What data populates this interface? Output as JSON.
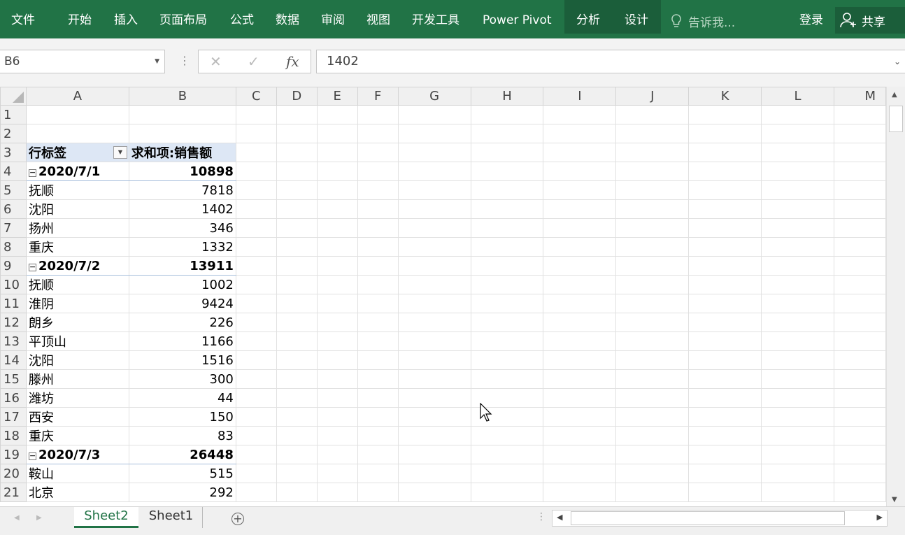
{
  "ribbon": {
    "tabs": [
      "文件",
      "开始",
      "插入",
      "页面布局",
      "公式",
      "数据",
      "审阅",
      "视图",
      "开发工具",
      "Power Pivot"
    ],
    "context_tabs": [
      "分析",
      "设计"
    ],
    "tell_me": "告诉我...",
    "login": "登录",
    "share": "共享",
    "bg_color": "#217346"
  },
  "formula_bar": {
    "name_box": "B6",
    "formula": "1402"
  },
  "grid": {
    "columns": [
      "A",
      "B",
      "C",
      "D",
      "E",
      "F",
      "G",
      "H",
      "I",
      "J",
      "K",
      "L",
      "M"
    ],
    "header_row": {
      "row": "3",
      "a": "行标签",
      "b": "求和项:销售额"
    },
    "rows": [
      {
        "row": "1",
        "type": "empty",
        "a": "",
        "b": ""
      },
      {
        "row": "2",
        "type": "empty",
        "a": "",
        "b": ""
      },
      {
        "row": "3",
        "type": "header",
        "a": "行标签",
        "b": "求和项:销售额"
      },
      {
        "row": "4",
        "type": "date",
        "a": "2020/7/1",
        "b": "10898"
      },
      {
        "row": "5",
        "type": "city",
        "a": "抚顺",
        "b": "7818"
      },
      {
        "row": "6",
        "type": "city",
        "a": "沈阳",
        "b": "1402"
      },
      {
        "row": "7",
        "type": "city",
        "a": "扬州",
        "b": "346"
      },
      {
        "row": "8",
        "type": "city",
        "a": "重庆",
        "b": "1332"
      },
      {
        "row": "9",
        "type": "date",
        "a": "2020/7/2",
        "b": "13911"
      },
      {
        "row": "10",
        "type": "city",
        "a": "抚顺",
        "b": "1002"
      },
      {
        "row": "11",
        "type": "city",
        "a": "淮阴",
        "b": "9424"
      },
      {
        "row": "12",
        "type": "city",
        "a": "朗乡",
        "b": "226"
      },
      {
        "row": "13",
        "type": "city",
        "a": "平顶山",
        "b": "1166"
      },
      {
        "row": "14",
        "type": "city",
        "a": "沈阳",
        "b": "1516"
      },
      {
        "row": "15",
        "type": "city",
        "a": "滕州",
        "b": "300"
      },
      {
        "row": "16",
        "type": "city",
        "a": "潍坊",
        "b": "44"
      },
      {
        "row": "17",
        "type": "city",
        "a": "西安",
        "b": "150"
      },
      {
        "row": "18",
        "type": "city",
        "a": "重庆",
        "b": "83"
      },
      {
        "row": "19",
        "type": "date",
        "a": "2020/7/3",
        "b": "26448"
      },
      {
        "row": "20",
        "type": "city",
        "a": "鞍山",
        "b": "515"
      },
      {
        "row": "21",
        "type": "city",
        "a": "北京",
        "b": "292"
      }
    ]
  },
  "sheets": {
    "tabs": [
      "Sheet2",
      "Sheet1"
    ],
    "active": "Sheet2"
  },
  "colors": {
    "pivot_header_bg": "#dde7f5",
    "active_tab_text": "#217346"
  }
}
